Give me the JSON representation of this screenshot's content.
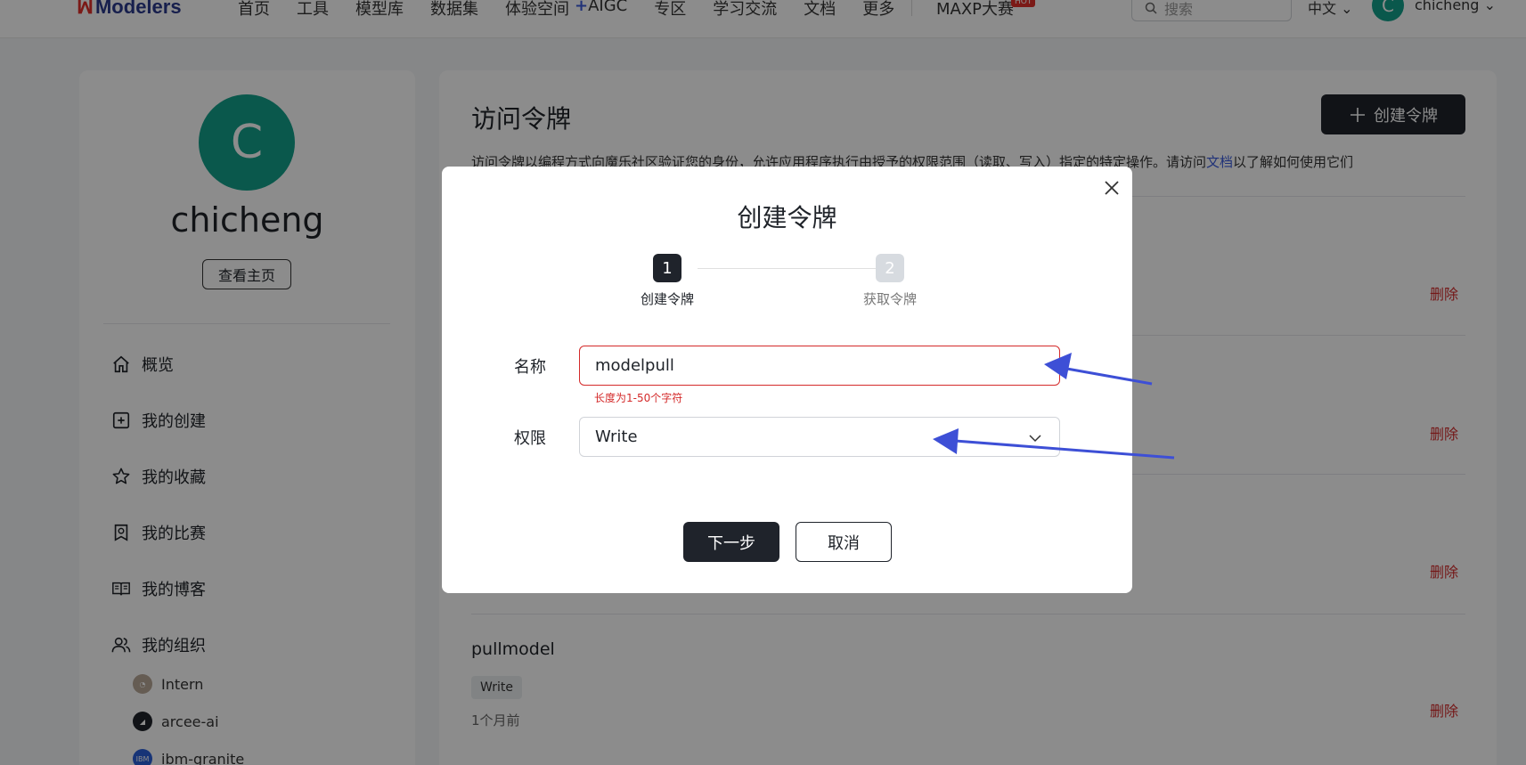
{
  "topnav": {
    "logo_text": "Modelers",
    "items": [
      "首页",
      "工具",
      "模型库",
      "数据集",
      "体验空间",
      "AIGC",
      "专区",
      "学习交流",
      "文档",
      "更多"
    ],
    "maxp": "MAXP大赛",
    "hot_badge": "HOT",
    "search_placeholder": "搜索",
    "language": "中文",
    "avatar_letter": "C",
    "username": "chicheng"
  },
  "sidebar": {
    "avatar_letter": "C",
    "username": "chicheng",
    "view_home": "查看主页",
    "menu": [
      {
        "label": "概览",
        "icon": "home-icon"
      },
      {
        "label": "我的创建",
        "icon": "plus-square-icon"
      },
      {
        "label": "我的收藏",
        "icon": "star-icon"
      },
      {
        "label": "我的比赛",
        "icon": "competition-icon"
      },
      {
        "label": "我的博客",
        "icon": "book-icon"
      },
      {
        "label": "我的组织",
        "icon": "users-icon"
      }
    ],
    "orgs": [
      {
        "name": "Intern",
        "color": "#8a7a6a"
      },
      {
        "name": "arcee-ai",
        "color": "#1f232b"
      },
      {
        "name": "ibm-granite",
        "color": "#2b5fd9"
      }
    ]
  },
  "main": {
    "title": "访问令牌",
    "create_button": "创建令牌",
    "description_prefix": "访问令牌以编程方式向魔乐社区验证您的身份，允许应用程序执行由授予的权限范围（读取、写入）指定的特定操作。请访问",
    "description_link": "文档",
    "description_suffix": "以了解如何使用它们",
    "delete_label": "删除",
    "last_token": {
      "name": "pullmodel",
      "permission": "Write",
      "time": "1个月前"
    }
  },
  "modal": {
    "title": "创建令牌",
    "steps": [
      {
        "num": "1",
        "label": "创建令牌",
        "active": true
      },
      {
        "num": "2",
        "label": "获取令牌",
        "active": false
      }
    ],
    "name_label": "名称",
    "name_value": "modelpull",
    "name_error": "长度为1-50个字符",
    "permission_label": "权限",
    "permission_value": "Write",
    "next_button": "下一步",
    "cancel_button": "取消"
  },
  "colors": {
    "accent_dark": "#1f232b",
    "error_red": "#d42a2a",
    "avatar_teal": "#13a08a",
    "annotation_arrow": "#3d4fd6"
  }
}
